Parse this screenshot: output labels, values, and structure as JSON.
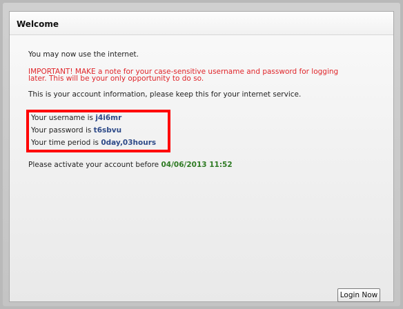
{
  "panel": {
    "title": "Welcome"
  },
  "messages": {
    "intro": "You may now use the internet.",
    "warning_line1": "IMPORTANT! MAKE a note for your case-sensitive username and password for logging",
    "warning_line2": "later. This will be your only opportunity to do so.",
    "info": "This is your account information, please keep this for your internet service."
  },
  "account": {
    "username_label": "Your username is ",
    "username": "j4i6mr",
    "password_label": "Your password is ",
    "password": "t6sbvu",
    "period_label": "Your time period is ",
    "period": "0day,03hours"
  },
  "activation": {
    "label": "Please activate your account before ",
    "deadline": "04/06/2013 11:52"
  },
  "buttons": {
    "login": "Login Now"
  },
  "colors": {
    "warning": "#e0252a",
    "account_value": "#2e4a88",
    "deadline": "#2d7a22",
    "highlight_box": "#ff0000"
  }
}
